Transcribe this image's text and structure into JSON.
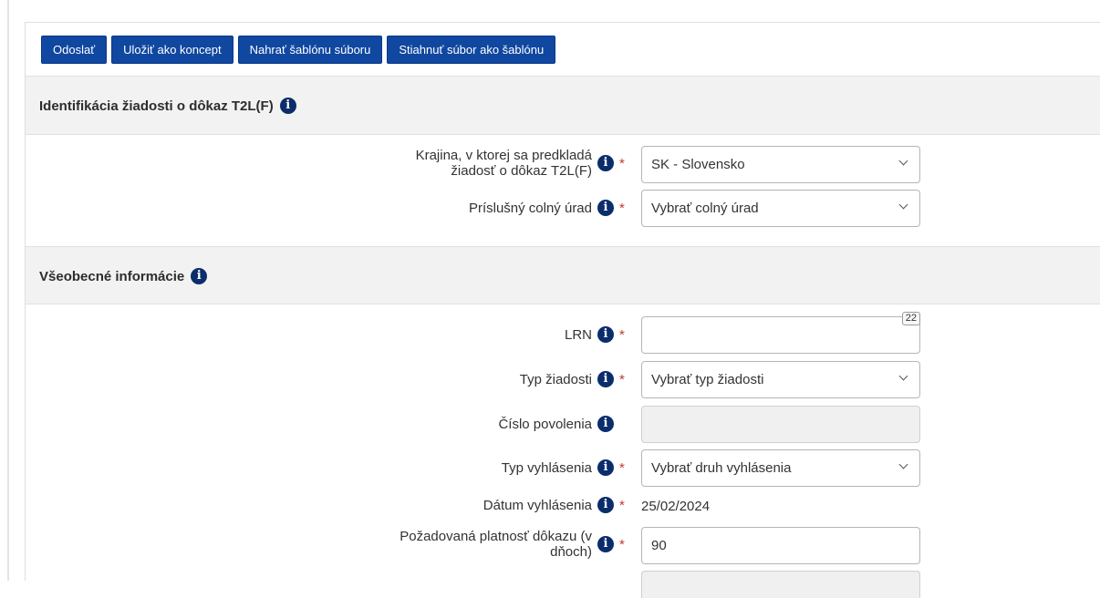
{
  "toolbar": {
    "send_label": "Odoslať",
    "save_draft_label": "Uložiť ako koncept",
    "upload_template_label": "Nahrať šablónu súboru",
    "download_template_label": "Stiahnuť súbor ako šablónu"
  },
  "section_identification": {
    "title": "Identifikácia žiadosti o dôkaz T2L(F)",
    "country": {
      "label_line1": "Krajina, v ktorej sa predkladá",
      "label_line2": "žiadosť o dôkaz T2L(F)",
      "value": "SK - Slovensko"
    },
    "customs_office": {
      "label": "Príslušný colný úrad",
      "value": "Vybrať colný úrad"
    }
  },
  "section_general": {
    "title": "Všeobecné informácie",
    "lrn": {
      "label": "LRN",
      "value": "",
      "counter": "22"
    },
    "request_type": {
      "label": "Typ žiadosti",
      "value": "Vybrať typ žiadosti"
    },
    "permit_number": {
      "label": "Číslo povolenia",
      "value": ""
    },
    "declaration_type": {
      "label": "Typ vyhlásenia",
      "value": "Vybrať druh vyhlásenia"
    },
    "declaration_date": {
      "label": "Dátum vyhlásenia",
      "value": "25/02/2024"
    },
    "validity": {
      "label_line1": "Požadovaná platnosť dôkazu (v",
      "label_line2": "dňoch)",
      "value": "90"
    }
  },
  "common": {
    "info_glyph": "i",
    "required_mark": "*"
  },
  "colors": {
    "button_bg": "#1047a0",
    "info_icon": "#0b2d6b",
    "required": "#c0392b",
    "section_bg": "#f2f2f2"
  }
}
